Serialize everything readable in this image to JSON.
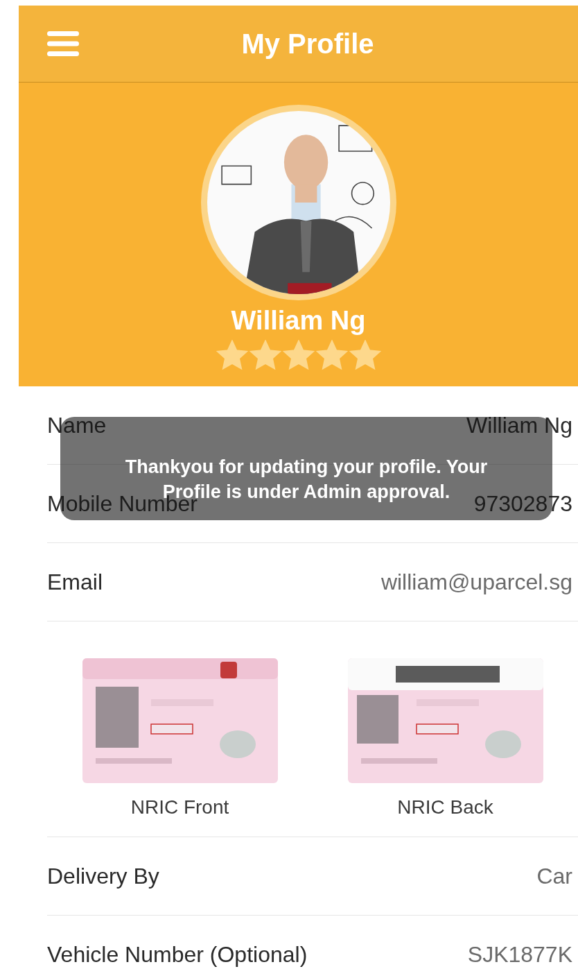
{
  "header": {
    "title": "My Profile"
  },
  "profile": {
    "name": "William Ng",
    "stars": 5
  },
  "fields": [
    {
      "label": "Name",
      "value": "William Ng"
    },
    {
      "label": "Mobile Number",
      "value": "97302873"
    },
    {
      "label": "Email",
      "value": "william@uparcel.sg"
    }
  ],
  "documents": [
    {
      "caption": "NRIC Front",
      "kind": "picture"
    },
    {
      "caption": "NRIC Back",
      "kind": "picture"
    }
  ],
  "details": [
    {
      "label": "Delivery By",
      "value": "Car"
    },
    {
      "label": "Vehicle Number (Optional)",
      "value": "SJK1877K"
    }
  ],
  "toast": {
    "message": "Thankyou for updating your profile. Your Profile is under Admin approval."
  }
}
